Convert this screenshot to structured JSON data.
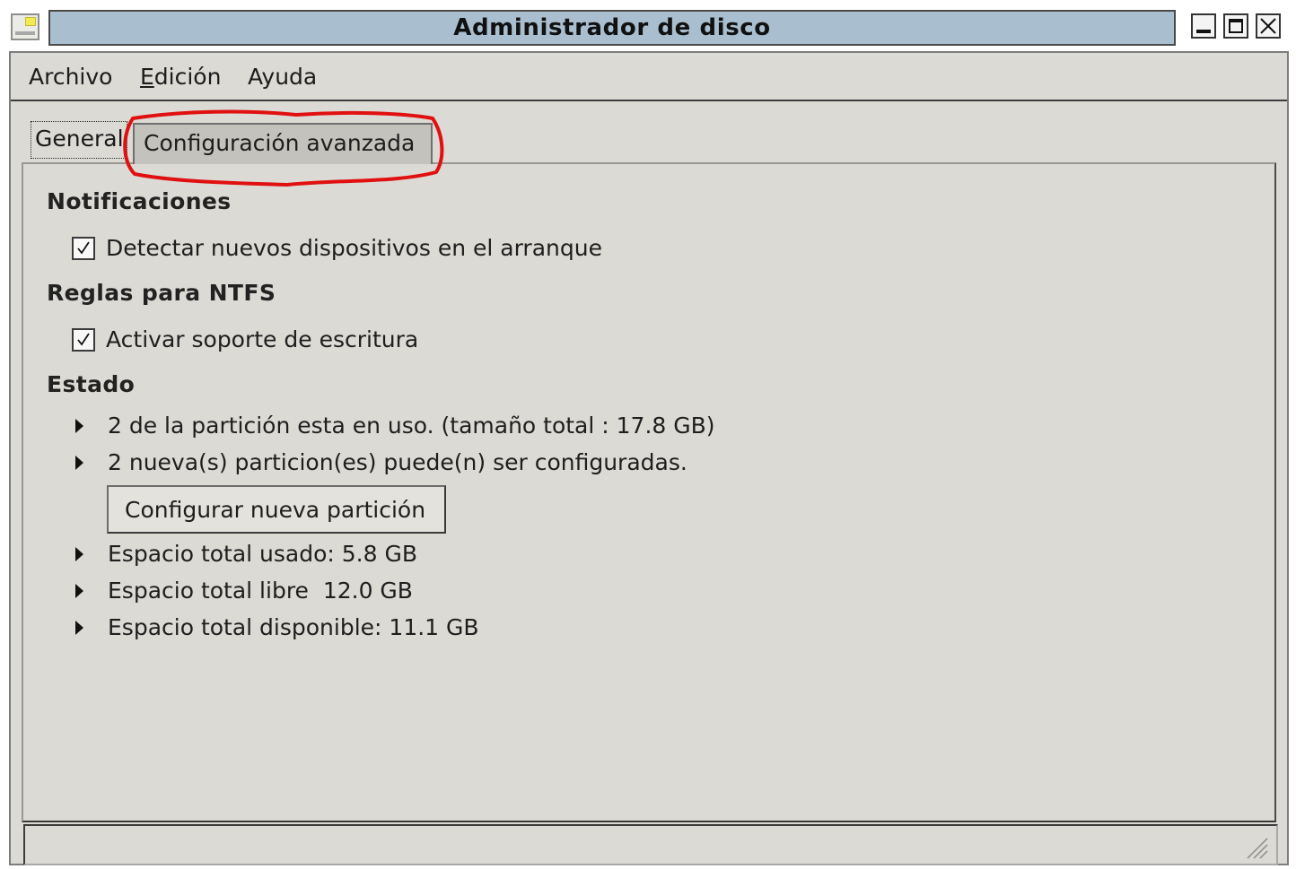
{
  "window": {
    "title": "Administrador de disco"
  },
  "menu": {
    "archivo": "Archivo",
    "edicion_mnemonic": "E",
    "edicion_rest": "dición",
    "ayuda": "Ayuda"
  },
  "tabs": [
    {
      "label": "General",
      "selected": true
    },
    {
      "label": "Configuración avanzada",
      "selected": false
    }
  ],
  "sections": {
    "notificaciones": {
      "title": "Notificaciones",
      "checkbox_label": "Detectar nuevos dispositivos en el arranque",
      "checked": true
    },
    "ntfs": {
      "title": "Reglas para NTFS",
      "checkbox_label": "Activar soporte de escritura",
      "checked": true
    },
    "estado": {
      "title": "Estado",
      "items": [
        "2 de la partición esta en uso. (tamaño total : 17.8 GB)",
        "2 nueva(s) particion(es) puede(n) ser configuradas.",
        "Espacio total usado: 5.8 GB",
        "Espacio total libre  12.0 GB",
        "Espacio total disponible: 11.1 GB"
      ],
      "button_label": "Configurar nueva partición"
    }
  },
  "colors": {
    "titlebar": "#a9bfcf",
    "window_bg": "#dcdad5",
    "annotation": "#e01010"
  },
  "icons": {
    "app": "disk-manager-icon",
    "status_item": "triangle-right-icon",
    "grip": "resize-grip-icon"
  }
}
